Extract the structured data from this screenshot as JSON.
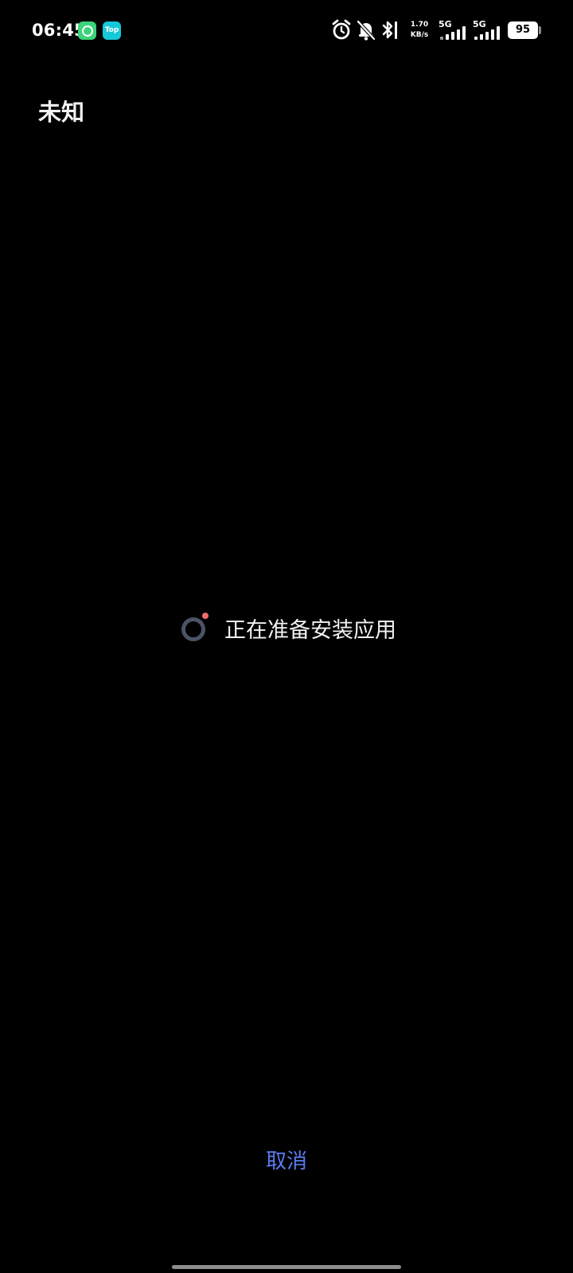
{
  "status_bar": {
    "time": "06:45",
    "notification_icons": [
      "app-notification-icon",
      "top-app-icon"
    ],
    "top_badge_label": "Top",
    "icons": [
      "alarm-icon",
      "bell-off-icon",
      "bluetooth-icon"
    ],
    "net_speed_value": "1.70",
    "net_speed_unit": "KB/s",
    "sim1_label": "5G",
    "sim2_label": "5G",
    "battery_level": "95"
  },
  "page": {
    "title": "未知",
    "loading_text": "正在准备安装应用",
    "cancel_label": "取消"
  },
  "colors": {
    "background": "#000000",
    "accent": "#5a7bf0",
    "spinner_ring": "#4b5466",
    "spinner_dot": "#f36b6b"
  }
}
